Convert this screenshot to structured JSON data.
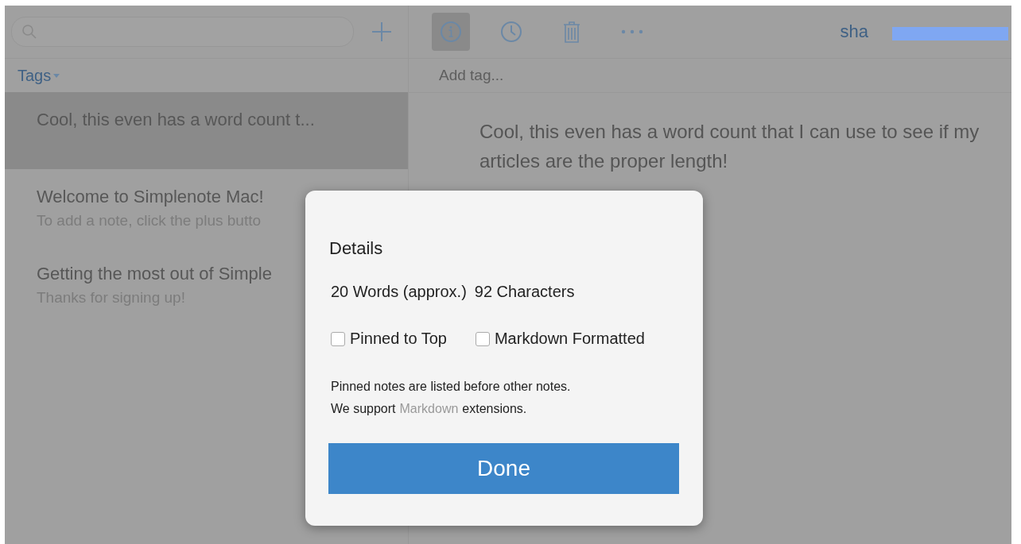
{
  "sidebar": {
    "tags_label": "Tags",
    "notes": [
      {
        "title": "Cool, this even has a word count t...",
        "selected": true
      },
      {
        "title": "Welcome to Simplenote Mac!",
        "preview": "To add a note, click the plus butto",
        "selected": false
      },
      {
        "title": "Getting the most out of Simple",
        "preview": "Thanks for signing up!",
        "selected": false
      }
    ]
  },
  "toolbar": {
    "buttons": [
      {
        "kind": "info",
        "selected": true
      },
      {
        "kind": "history",
        "selected": false
      },
      {
        "kind": "trash",
        "selected": false
      },
      {
        "kind": "more",
        "selected": false
      }
    ],
    "account": "sha"
  },
  "editor": {
    "tag_placeholder": "Add tag...",
    "text": "Cool, this even has a word count that I can use to see if my articles are the proper length!"
  },
  "dialog": {
    "title": "Details",
    "words": "20 Words (approx.)",
    "characters": "92 Characters",
    "options": [
      {
        "label": "Pinned to Top",
        "checked": false
      },
      {
        "label": "Markdown Formatted",
        "checked": false
      }
    ],
    "help_1": "Pinned notes are listed before other notes.",
    "help_2_before": "We support",
    "help_2_link": "Markdown",
    "help_2_after": "extensions.",
    "done": "Done"
  }
}
